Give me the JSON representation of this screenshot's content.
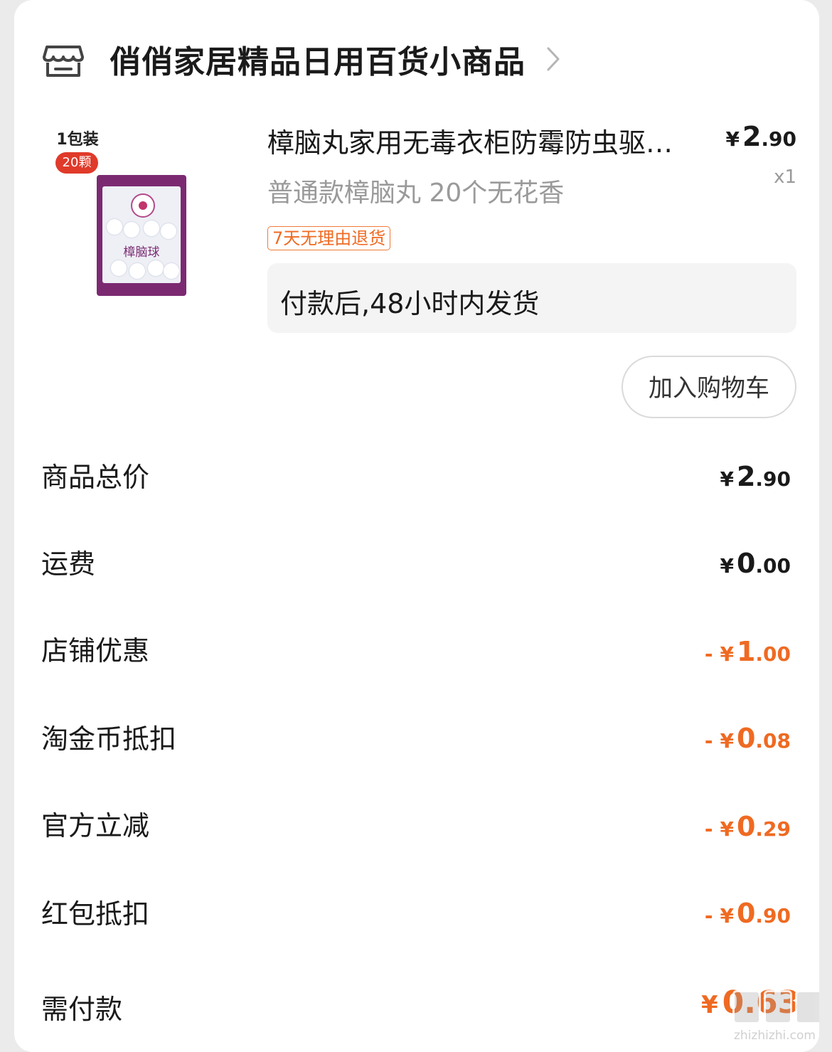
{
  "store": {
    "name": "俏俏家居精品日用百货小商品",
    "icon": "store-icon"
  },
  "product": {
    "image_label": "1包装",
    "image_count": "20颗",
    "image_bag_text": "樟脑球",
    "title": "樟脑丸家用无毒衣柜防霉防虫驱虫防蛀防潮除味",
    "price_currency": "¥",
    "price_int": "2",
    "price_dec": ".90",
    "spec": "普通款樟脑丸 20个无花香",
    "qty": "x1",
    "return_tag": "7天无理由退货",
    "shipping": "付款后,48小时内发货",
    "cart_button": "加入购物车"
  },
  "summary": [
    {
      "label": "商品总价",
      "minus": "",
      "cur": "¥",
      "int": "2",
      "dec": ".90",
      "negative": false
    },
    {
      "label": "运费",
      "minus": "",
      "cur": "¥",
      "int": "0",
      "dec": ".00",
      "negative": false
    },
    {
      "label": "店铺优惠",
      "minus": "-",
      "cur": "¥",
      "int": "1",
      "dec": ".00",
      "negative": true
    },
    {
      "label": "淘金币抵扣",
      "minus": "-",
      "cur": "¥",
      "int": "0",
      "dec": ".08",
      "negative": true
    },
    {
      "label": "官方立减",
      "minus": "-",
      "cur": "¥",
      "int": "0",
      "dec": ".29",
      "negative": true
    },
    {
      "label": "红包抵扣",
      "minus": "-",
      "cur": "¥",
      "int": "0",
      "dec": ".90",
      "negative": true
    }
  ],
  "payment": {
    "label": "需付款",
    "cur": "¥",
    "value": "0.63"
  },
  "watermark": {
    "site": "zhizhizhi.com"
  },
  "colors": {
    "accent": "#ef6a22",
    "text": "#1a1a1a",
    "muted": "#9a9a9a",
    "background": "#ebebeb"
  }
}
